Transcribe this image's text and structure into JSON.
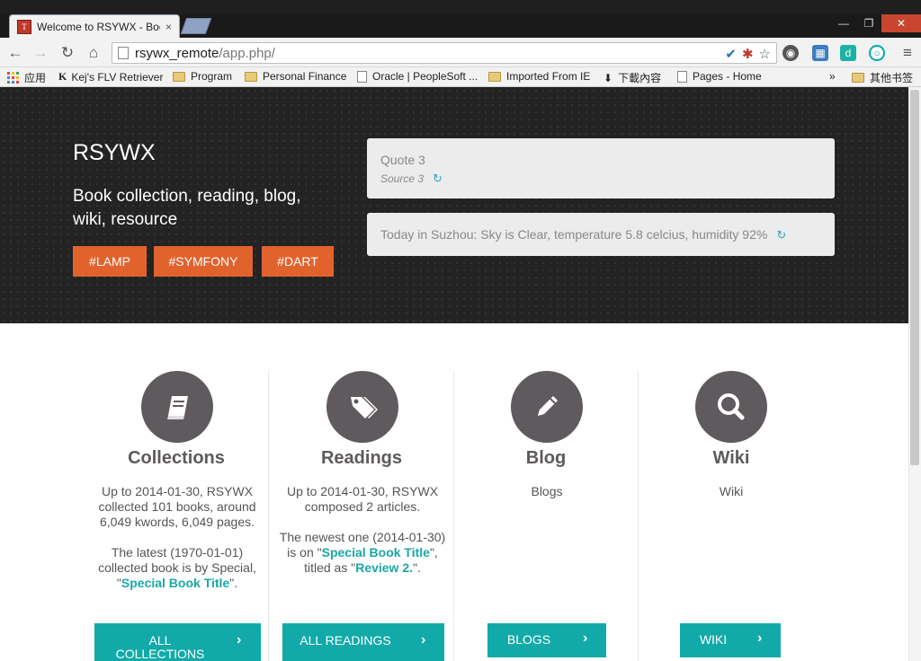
{
  "browser": {
    "tab_title": "Welcome to RSYWX - Boo",
    "tab_close": "×",
    "url_host": "rsywx_remote",
    "url_path": "/app.php/",
    "win_min": "—",
    "win_max": "❐",
    "win_close": "✕"
  },
  "bookmarks": [
    {
      "label": "应用"
    },
    {
      "label": "Kej's FLV Retriever"
    },
    {
      "label": "Program"
    },
    {
      "label": "Personal Finance"
    },
    {
      "label": "Oracle | PeopleSoft ..."
    },
    {
      "label": "Imported From IE"
    },
    {
      "label": "下載內容"
    },
    {
      "label": "Pages - Home"
    },
    {
      "label": "»"
    },
    {
      "label": "其他书签"
    }
  ],
  "hero": {
    "brand": "RSYWX",
    "tagline": "Book collection, reading, blog, wiki, resource",
    "tags": [
      "#LAMP",
      "#SYMFONY",
      "#DART"
    ],
    "quote": "Quote 3",
    "source": "Source 3",
    "weather": "Today in Suzhou: Sky is Clear, temperature 5.8 celcius, humidity 92%"
  },
  "columns": [
    {
      "title": "Collections",
      "text1": "Up to 2014-01-30, RSYWX collected 101 books, around 6,049 kwords, 6,049 pages.",
      "text2a": "The latest (1970-01-01) collected book is by Special, \"",
      "text2link": "Special Book Title",
      "text2b": "\".",
      "button": "ALL COLLECTIONS"
    },
    {
      "title": "Readings",
      "text1": "Up to 2014-01-30, RSYWX composed 2 articles.",
      "text2a": "The newest one (2014-01-30) is on \"",
      "text2link": "Special Book Title",
      "text2b": "\", titled as \"",
      "text2link2": "Review 2.",
      "text2c": "\".",
      "button": "ALL READINGS"
    },
    {
      "title": "Blog",
      "text1": "Blogs",
      "button": "BLOGS"
    },
    {
      "title": "Wiki",
      "text1": "Wiki",
      "button": "WIKI"
    }
  ],
  "colors": {
    "accent_orange": "#e2622e",
    "accent_teal": "#12aaa8",
    "hero_bg": "#232323",
    "icon_circle": "#5f5a5e"
  }
}
